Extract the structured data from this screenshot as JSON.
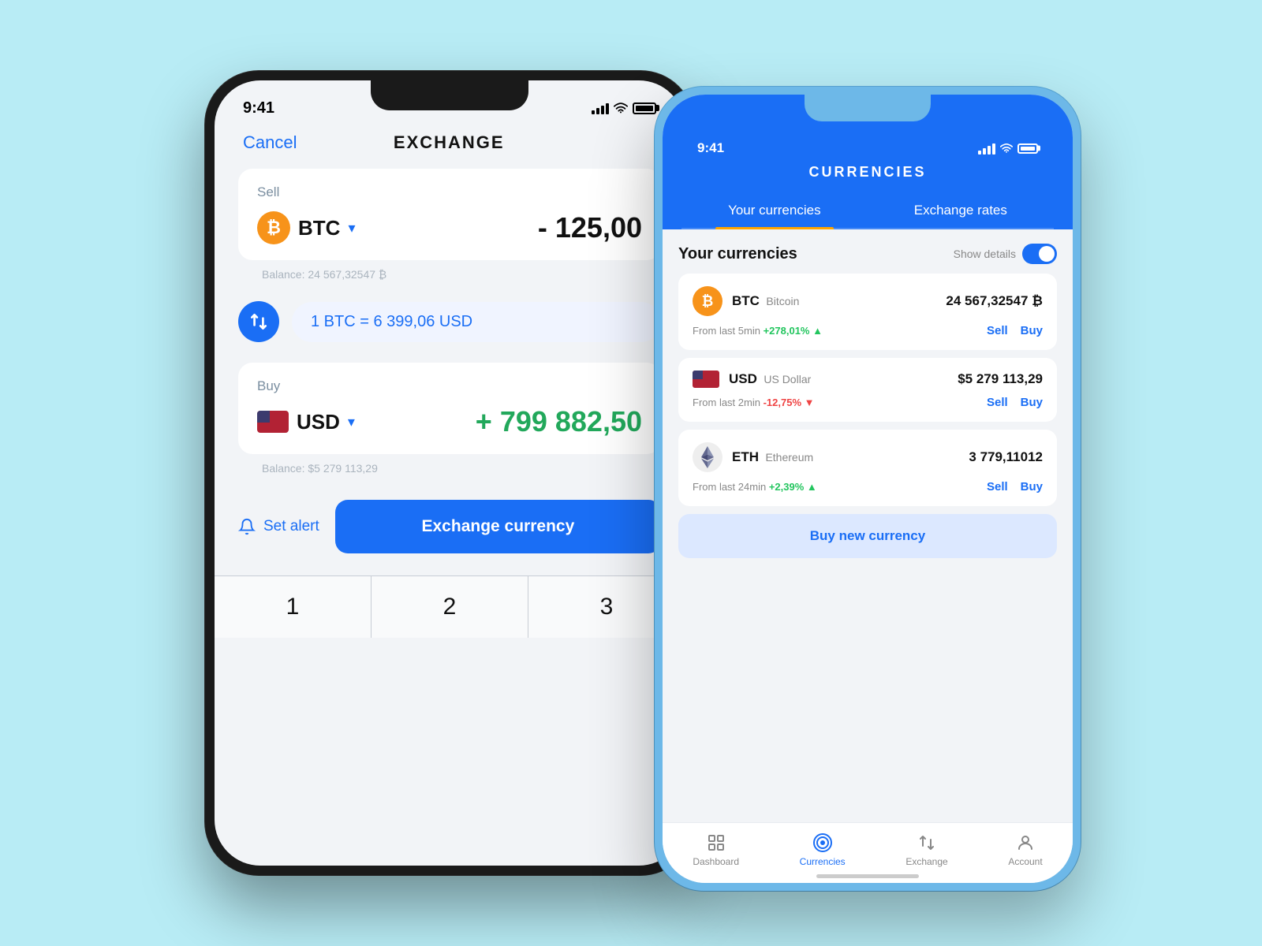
{
  "background_color": "#b8ecf5",
  "phone_left": {
    "status_time": "9:41",
    "header": {
      "cancel_label": "Cancel",
      "title": "EXCHANGE"
    },
    "sell_card": {
      "label": "Sell",
      "currency": "BTC",
      "amount": "- 125,00",
      "balance": "Balance:  24 567,32547 ₿"
    },
    "rate": {
      "text": "1 BTC = 6 399,06 USD"
    },
    "buy_card": {
      "label": "Buy",
      "currency": "USD",
      "amount": "+ 799 882,50",
      "balance": "Balance:  $5 279 113,29"
    },
    "alert_btn": "Set alert",
    "exchange_btn": "Exchange currency",
    "keyboard": [
      "1",
      "2",
      "3"
    ]
  },
  "phone_right": {
    "status_time": "9:41",
    "header": {
      "title": "CURRENCIES",
      "tab1": "Your currencies",
      "tab2": "Exchange rates"
    },
    "section_title": "Your currencies",
    "show_details_label": "Show details",
    "currencies": [
      {
        "symbol": "BTC",
        "name": "Bitcoin",
        "amount": "24 567,32547 ₿",
        "change_period": "From last 5min",
        "change": "+278,01%",
        "change_type": "positive",
        "arrow": "▲",
        "sell": "Sell",
        "buy": "Buy"
      },
      {
        "symbol": "USD",
        "name": "US Dollar",
        "amount": "$5 279 113,29",
        "change_period": "From last 2min",
        "change": "-12,75%",
        "change_type": "negative",
        "arrow": "▼",
        "sell": "Sell",
        "buy": "Buy"
      },
      {
        "symbol": "ETH",
        "name": "Ethereum",
        "amount": "3 779,11012",
        "change_period": "From last 24min",
        "change": "+2,39%",
        "change_type": "positive",
        "arrow": "▲",
        "sell": "Sell",
        "buy": "Buy"
      }
    ],
    "buy_new_label": "Buy new currency",
    "nav": [
      {
        "label": "Dashboard",
        "active": false
      },
      {
        "label": "Currencies",
        "active": true
      },
      {
        "label": "Exchange",
        "active": false
      },
      {
        "label": "Account",
        "active": false
      }
    ]
  }
}
